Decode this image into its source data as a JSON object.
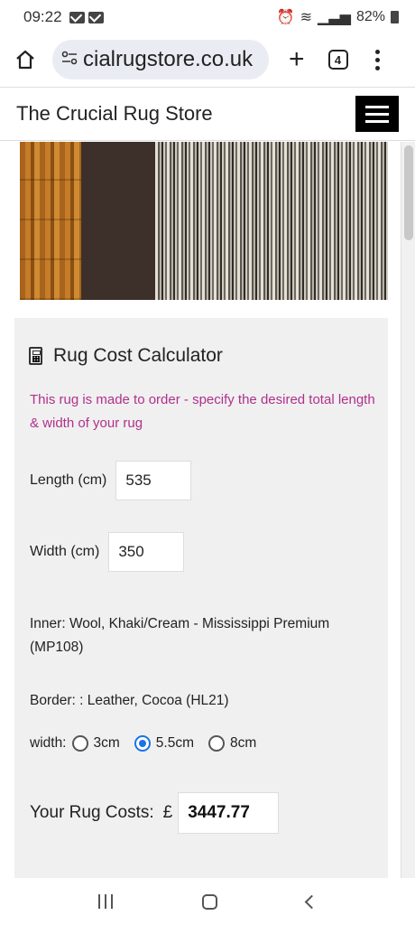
{
  "status_bar": {
    "time": "09:22",
    "battery": "82%"
  },
  "browser": {
    "url": "cialrugstore.co.uk",
    "tab_count": "4"
  },
  "site": {
    "title": "The Crucial Rug Store"
  },
  "calculator": {
    "title": "Rug Cost Calculator",
    "notice": "This rug is made to order - specify the desired total length & width of your rug",
    "length_label": "Length (cm)",
    "length_value": "535",
    "width_label": "Width (cm)",
    "width_value": "350",
    "inner": "Inner: Wool, Khaki/Cream - Mississippi Premium (MP108)",
    "border": "Border: : Leather, Cocoa (HL21)",
    "border_width_label": "width:",
    "border_width_options": [
      "3cm",
      "5.5cm",
      "8cm"
    ],
    "border_width_selected": "5.5cm",
    "cost_label": "Your Rug Costs:",
    "currency": "£",
    "cost_value": "3447.77"
  },
  "colors": {
    "notice": "#b0308c",
    "accent": "#1a73e8"
  }
}
